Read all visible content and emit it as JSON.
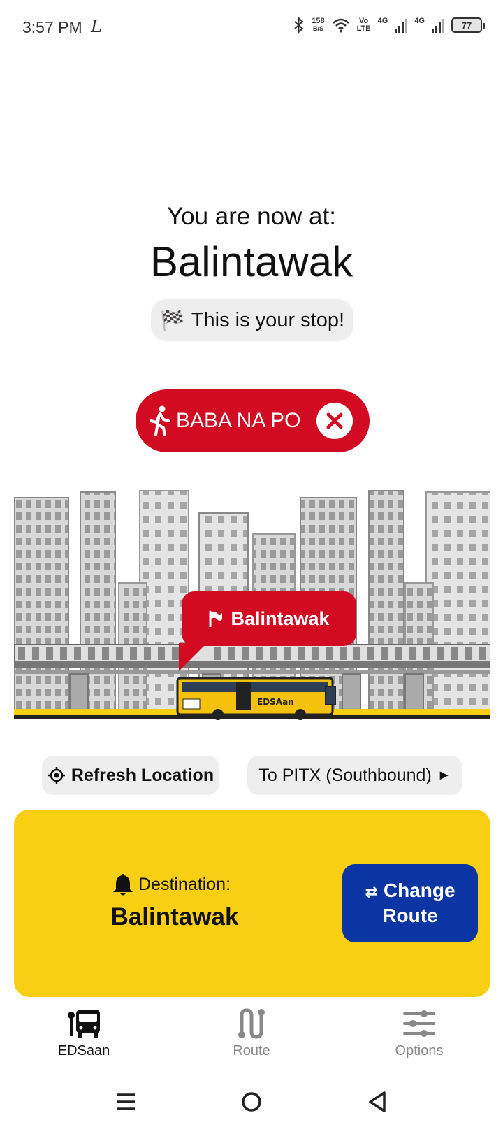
{
  "status_bar": {
    "time": "3:57 PM",
    "net_speed_value": "158",
    "net_speed_unit": "B/S",
    "volte_top": "Vo",
    "volte_bottom": "LTE",
    "sim1_label": "4G",
    "sim2_label": "4G",
    "battery": "77"
  },
  "location": {
    "heading": "You are now at:",
    "station": "Balintawak",
    "stop_badge": "This is your stop!",
    "stop_badge_icon": "🏁"
  },
  "alight_button": {
    "label": "BABA NA PO"
  },
  "map_callout": {
    "station": "Balintawak"
  },
  "bus_label": "EDSAan",
  "controls": {
    "refresh_label": "Refresh Location",
    "direction_label": "To PITX (Southbound)",
    "direction_arrow": "►"
  },
  "destination": {
    "label": "Destination:",
    "value": "Balintawak",
    "change_route_swap": "⇄",
    "change_route_label_1": "Change",
    "change_route_label_2": "Route"
  },
  "bottom_nav": {
    "items": [
      {
        "label": "EDSaan",
        "icon": "bus-stop-icon",
        "active": true
      },
      {
        "label": "Route",
        "icon": "route-icon",
        "active": false
      },
      {
        "label": "Options",
        "icon": "sliders-icon",
        "active": false
      }
    ]
  },
  "colors": {
    "red": "#d20a22",
    "yellow": "#f9cf13",
    "blue": "#0a35a3",
    "pill_gray": "#eeeeee"
  }
}
